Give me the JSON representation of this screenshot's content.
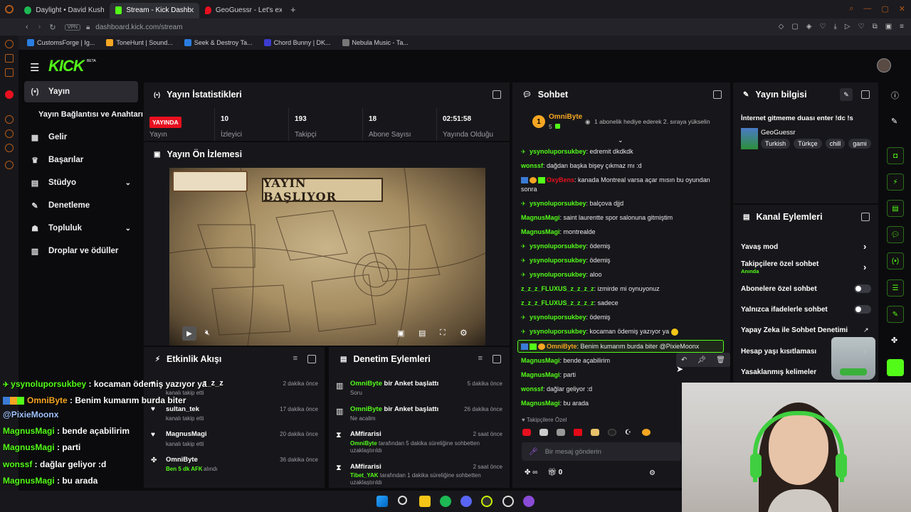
{
  "browser": {
    "tabs": [
      {
        "label": "Daylight • David Kushn",
        "icon_color": "#1db954"
      },
      {
        "label": "Stream - Kick Dashboard",
        "icon_color": "#53fc18",
        "active": true
      },
      {
        "label": "GeoGuessr - Let's explore",
        "icon_color": "#e8101f"
      }
    ],
    "new_tab": "+",
    "vpn": "VPN",
    "url": "dashboard.kick.com/stream",
    "bookmarks": [
      {
        "label": "CustomsForge | Ig...",
        "color": "#2a7de1"
      },
      {
        "label": "ToneHunt | Sound...",
        "color": "#f5a623"
      },
      {
        "label": "Seek & Destroy Ta...",
        "color": "#2a7de1"
      },
      {
        "label": "Chord Bunny | DK...",
        "color": "#3b3bd0"
      },
      {
        "label": "Nebula Music - Ta...",
        "color": "#777777"
      }
    ]
  },
  "kick": {
    "logo": "KICK",
    "logo_tag": "BETA",
    "nav": [
      {
        "label": "Yayın",
        "icon": "broadcast-icon",
        "glyph": "(•)",
        "active": true
      },
      {
        "label": "Yayın Bağlantısı ve Anahtarı",
        "icon": "",
        "glyph": ""
      },
      {
        "label": "Gelir",
        "icon": "chart-icon",
        "glyph": "▦"
      },
      {
        "label": "Başarılar",
        "icon": "trophy-icon",
        "glyph": "♛"
      },
      {
        "label": "Stüdyo",
        "icon": "studio-icon",
        "glyph": "▤",
        "chevron": true
      },
      {
        "label": "Denetleme",
        "icon": "wrench-icon",
        "glyph": "✎"
      },
      {
        "label": "Topluluk",
        "icon": "community-icon",
        "glyph": "☗",
        "chevron": true
      },
      {
        "label": "Droplar ve ödüller",
        "icon": "drops-icon",
        "glyph": "▥"
      }
    ],
    "stats": {
      "title": "Yayın İstatistikleri",
      "live_badge": "YAYINDA",
      "items": [
        {
          "value": "",
          "label": "Yayın"
        },
        {
          "value": "10",
          "label": "İzleyici"
        },
        {
          "value": "193",
          "label": "Takipçi"
        },
        {
          "value": "18",
          "label": "Abone Sayısı"
        },
        {
          "value": "02:51:58",
          "label": "Yayında Olduğu"
        }
      ]
    },
    "preview": {
      "title": "Yayın Ön İzlemesi",
      "banner": "YAYIN BAŞLIYOR"
    },
    "activity": {
      "title": "Etkinlik Akışı",
      "items": [
        {
          "name": "",
          "sub": "kanalı takip etti",
          "time": "2 dakika önce",
          "icon": "heart-icon"
        },
        {
          "name": "sultan_tek",
          "sub": "kanalı takip etti",
          "time": "17 dakika önce",
          "icon": "heart-icon"
        },
        {
          "name": "MagnusMagi",
          "sub": "kanalı takip etti",
          "time": "20 dakika önce",
          "icon": "heart-icon"
        },
        {
          "name": "OmniByte",
          "sub": "Ben 5 dk AFK",
          "sub2": "alındı",
          "time": "36 dakika önce",
          "icon": "channel-points-icon"
        }
      ]
    },
    "moderation": {
      "title": "Denetim Eylemleri",
      "items": [
        {
          "name": "OmniByte",
          "action": "bir Anket başlattı",
          "sub": "Soru",
          "time": "5 dakika önce",
          "icon": "poll-icon"
        },
        {
          "name": "OmniByte",
          "action": "bir Anket başlattı",
          "sub": "Ne acalim",
          "time": "26 dakika önce",
          "icon": "poll-icon"
        },
        {
          "name": "AMfirarisi",
          "action": "",
          "by": "OmniByte",
          "sub": "tarafından 5 dakika süreliğine sohbetten uzaklaştırıldı",
          "time": "2 saat önce",
          "icon": "hourglass-icon"
        },
        {
          "name": "AMfirarisi",
          "action": "",
          "by": "Tibet_YAK",
          "sub": "tarafından 1 dakika süreliğine sohbetten uzaklaştırıldı",
          "time": "2 saat önce",
          "icon": "hourglass-icon"
        }
      ]
    },
    "chat": {
      "title": "Sohbet",
      "pinned_user": "OmniByte",
      "pinned_level": "5",
      "pinned_msg": "1 abonelik hediye ederek 2. sıraya yükselin",
      "messages": [
        {
          "user": "ysynoluporsukbey",
          "text": "edremit dkdkdk",
          "color": "green",
          "badge": true
        },
        {
          "user": "wonssf",
          "text": "dağdan başka bişey çıkmaz mı :d",
          "color": "green"
        },
        {
          "user": "OxyBens",
          "text": "kanada Montreal varsa açar mısın bu oyundan",
          "text2": "sonra",
          "color": "red",
          "badges3": true
        },
        {
          "user": "ysynoluporsukbey",
          "text": "balçova djjd",
          "color": "green",
          "badge": true
        },
        {
          "user": "MagnusMagi",
          "text": "saint laurentte spor salonuna gitmiştim",
          "color": "green"
        },
        {
          "user": "MagnusMagi",
          "text": "montrealde",
          "color": "green"
        },
        {
          "user": "ysynoluporsukbey",
          "text": "ödemiş",
          "color": "green",
          "badge": true
        },
        {
          "user": "ysynoluporsukbey",
          "text": "ödemiş",
          "color": "green",
          "badge": true
        },
        {
          "user": "ysynoluporsukbey",
          "text": "aloo",
          "color": "green",
          "badge": true
        },
        {
          "user": "z_z_z_FLUXUS_z_z_z_z",
          "text": "izmirde mi oynuyonuz",
          "color": "green"
        },
        {
          "user": "z_z_z_FLUXUS_z_z_z_z",
          "text": "sadece",
          "color": "green"
        },
        {
          "user": "ysynoluporsukbey",
          "text": "ödemiş",
          "color": "green",
          "badge": true
        },
        {
          "user": "ysynoluporsukbey",
          "text": "kocaman ödemiş yazıyor ya",
          "color": "green",
          "badge": true,
          "emoji": true
        },
        {
          "user": "OmniByte",
          "text": "Benim kumarım burda biter @PixieMoonx",
          "color": "orange",
          "highlight": true
        },
        {
          "user": "MagnusMagi",
          "text": "bende açabilirim",
          "color": "green"
        },
        {
          "user": "MagnusMagi",
          "text": "parti",
          "color": "green"
        },
        {
          "user": "wonssf",
          "text": "dağlar geliyor :d",
          "color": "green"
        },
        {
          "user": "MagnusMagi",
          "text": "bu arada",
          "color": "green"
        }
      ],
      "followers_only": "Takipçilere Özel",
      "input_placeholder": "Bir mesaj gönderin",
      "points": "0"
    },
    "stream_info": {
      "title": "Yayın bilgisi",
      "stream_title": "İnternet gitmeme duası enter !dc !s",
      "category": "GeoGuessr",
      "tags": [
        "Turkish",
        "Türkçe",
        "chill",
        "gami"
      ]
    },
    "channel_actions": {
      "title": "Kanal Eylemleri",
      "items": [
        {
          "label": "Yavaş mod",
          "control": "chevron"
        },
        {
          "label": "Takipçilere özel sohbet",
          "sub": "Anında",
          "control": "chevron"
        },
        {
          "label": "Abonelere özel sohbet",
          "control": "toggle"
        },
        {
          "label": "Yalnızca ifadelerle sohbet",
          "control": "toggle"
        },
        {
          "label": "Yapay Zeka ile Sohbet Denetimi",
          "control": "link"
        },
        {
          "label": "Hesap yaşı kısıtlaması",
          "control": "chevron"
        },
        {
          "label": "Yasaklanmış kelimeler",
          "control": ""
        }
      ]
    }
  },
  "overlay_chat": [
    {
      "user": "ysynoluporsukbey",
      "text": " : kocaman ödemiş yazıyor ya",
      "color": "#53fc18"
    },
    {
      "user": "OmniByte",
      "text": " : Benim kumarım burda biter",
      "color": "#f5a623"
    },
    {
      "user": "",
      "text": "@PixieMoonx",
      "color": "#9fc2ff"
    },
    {
      "user": "MagnusMagi",
      "text": " : bende açabilirim",
      "color": "#53fc18"
    },
    {
      "user": "MagnusMagi",
      "text": " : parti",
      "color": "#53fc18"
    },
    {
      "user": "wonssf",
      "text": " : dağlar geliyor :d",
      "color": "#53fc18"
    },
    {
      "user": "MagnusMagi",
      "text": " : bu arada",
      "color": "#53fc18"
    }
  ],
  "overlay_fragment": "z_z_z",
  "taskbar": [
    "windows-icon",
    "search-icon",
    "folder-icon",
    "spotify-icon",
    "discord-icon",
    "obs-icon",
    "github-icon",
    "app-icon"
  ]
}
